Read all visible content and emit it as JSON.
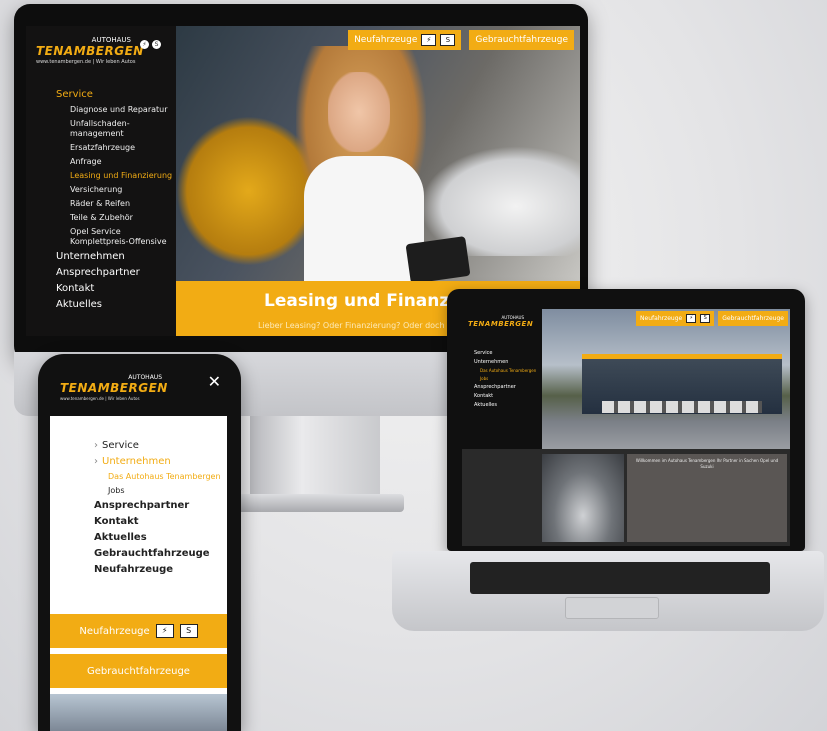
{
  "brand": {
    "pre": "AUTOHAUS",
    "name": "TENAMBERGEN",
    "sub": "www.tenambergen.de",
    "sub2": "Wir leben Autos"
  },
  "desktop": {
    "top_buttons": {
      "new": "Neufahrzeuge",
      "used": "Gebrauchtfahrzeuge"
    },
    "nav": [
      {
        "label": "Service",
        "level": 1,
        "active": true
      },
      {
        "label": "Diagnose und Reparatur",
        "level": 2
      },
      {
        "label": "Unfallschaden-management",
        "level": 2
      },
      {
        "label": "Ersatzfahrzeuge",
        "level": 2
      },
      {
        "label": "Anfrage",
        "level": 2
      },
      {
        "label": "Leasing und Finanzierung",
        "level": 2,
        "active": true
      },
      {
        "label": "Versicherung",
        "level": 2
      },
      {
        "label": "Räder & Reifen",
        "level": 2
      },
      {
        "label": "Teile & Zubehör",
        "level": 2
      },
      {
        "label": "Opel Service Komplettpreis-Offensive",
        "level": 2
      },
      {
        "label": "Unternehmen",
        "level": 1
      },
      {
        "label": "Ansprechpartner",
        "level": 1
      },
      {
        "label": "Kontakt",
        "level": 1
      },
      {
        "label": "Aktuelles",
        "level": 1
      }
    ],
    "banner_title": "Leasing und Finanzierungslö",
    "banner_sub": "Lieber Leasing? Oder Finanzierung? Oder doch lieber? Bei uns finden"
  },
  "laptop": {
    "top_buttons": {
      "new": "Neufahrzeuge",
      "used": "Gebrauchtfahrzeuge"
    },
    "nav": [
      "Service",
      "Unternehmen",
      "Das Autohaus Tenambergen",
      "Jobs",
      "Ansprechpartner",
      "Kontakt",
      "Aktuelles"
    ],
    "text": "Willkommen im Autohaus Tenambergen Ihr Partner in Sachen Opel und Suzuki"
  },
  "phone": {
    "close": "✕",
    "nav": [
      {
        "label": "Service",
        "type": "chev"
      },
      {
        "label": "Unternehmen",
        "type": "chev-active"
      },
      {
        "label": "Das Autohaus Tenambergen",
        "type": "subactive"
      },
      {
        "label": "Jobs",
        "type": "sub"
      },
      {
        "label": "Ansprechpartner",
        "type": "bold"
      },
      {
        "label": "Kontakt",
        "type": "bold"
      },
      {
        "label": "Aktuelles",
        "type": "bold"
      },
      {
        "label": "Gebrauchtfahrzeuge",
        "type": "bold"
      },
      {
        "label": "Neufahrzeuge",
        "type": "bold"
      }
    ],
    "btn_new": "Neufahrzeuge",
    "btn_used": "Gebrauchtfahrzeuge"
  },
  "colors": {
    "accent": "#f2ac14",
    "dark": "#111111"
  },
  "icons": [
    "opel-icon",
    "suzuki-icon",
    "close-icon",
    "chevron-right-icon"
  ]
}
